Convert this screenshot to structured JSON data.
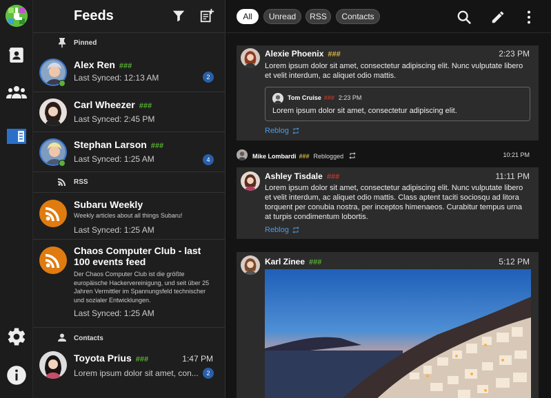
{
  "panel": {
    "title": "Feeds"
  },
  "sections": {
    "pinned": "Pinned",
    "rss": "RSS",
    "contacts": "Contacts"
  },
  "pinned": [
    {
      "name": "Alex Ren",
      "hashes": "###",
      "sync": "Last Synced: 12:13 AM",
      "badge": "2"
    },
    {
      "name": "Carl Wheezer",
      "hashes": "###",
      "sync": "Last Synced: 2:45 PM"
    },
    {
      "name": "Stephan Larson",
      "hashes": "###",
      "sync": "Last Synced: 1:25 AM",
      "badge": "4"
    }
  ],
  "rss": [
    {
      "name": "Subaru Weekly",
      "desc": "Weekly articles about all things Subaru!",
      "sync": "Last Synced: 1:25 AM"
    },
    {
      "name": "Chaos Computer Club - last 100 events feed",
      "desc": "Der Chaos Computer Club ist die größte europäische Hackervereinigung, und seit über 25 Jahren Vermittler im Spannungsfeld technischer und sozialer Entwicklungen.",
      "sync": "Last Synced: 1:25 AM"
    }
  ],
  "contacts": [
    {
      "name": "Toyota Prius",
      "hashes": "###",
      "time": "1:47 PM",
      "preview": "Lorem ipsum dolor sit amet, con...",
      "badge": "2"
    }
  ],
  "filters": [
    "All",
    "Unread",
    "RSS",
    "Contacts"
  ],
  "posts": {
    "p1": {
      "author": "Alexie Phoenix",
      "hashes": "###",
      "time": "2:23 PM",
      "text": "Lorem ipsum dolor sit amet, consectetur adipiscing elit. Nunc vulputate libero et velit interdum, ac aliquet odio mattis.",
      "quote": {
        "author": "Tom Cruise",
        "hashes": "###",
        "time": "2:23 PM",
        "text": "Lorem ipsum dolor sit amet, consectetur adipiscing elit."
      },
      "reblog": "Reblog"
    },
    "rebloggedBy": {
      "author": "Mike Lombardi",
      "hashes": "###",
      "label": "Reblogged",
      "time": "10:21 PM"
    },
    "p2": {
      "author": "Ashley Tisdale",
      "hashes": "###",
      "time": "11:11 PM",
      "text": "Lorem ipsum dolor sit amet, consectetur adipiscing elit. Nunc vulputate libero et velit interdum, ac aliquet odio mattis. Class aptent taciti sociosqu ad litora torquent per conubia nostra, per inceptos himenaeos. Curabitur tempus urna at turpis condimentum lobortis.",
      "reblog": "Reblog"
    },
    "p3": {
      "author": "Karl Zinee",
      "hashes": "###",
      "time": "5:12 PM"
    }
  },
  "colors": {
    "accent": "#4d9be6",
    "badge": "#2a5fa8",
    "rssOrange": "#e07b10",
    "online": "#59b333",
    "hashGreen": "#59b333",
    "hashYellow": "#e0b840",
    "hashRed": "#c0392b"
  },
  "icons": {
    "rail": [
      "app-logo",
      "contacts-card-icon",
      "group-icon",
      "feed-reader-icon",
      "settings-gear-icon",
      "info-icon"
    ],
    "panel": [
      "filter-icon",
      "new-feed-icon"
    ],
    "topbar": [
      "search-icon",
      "compose-pencil-icon",
      "more-vertical-icon"
    ]
  }
}
